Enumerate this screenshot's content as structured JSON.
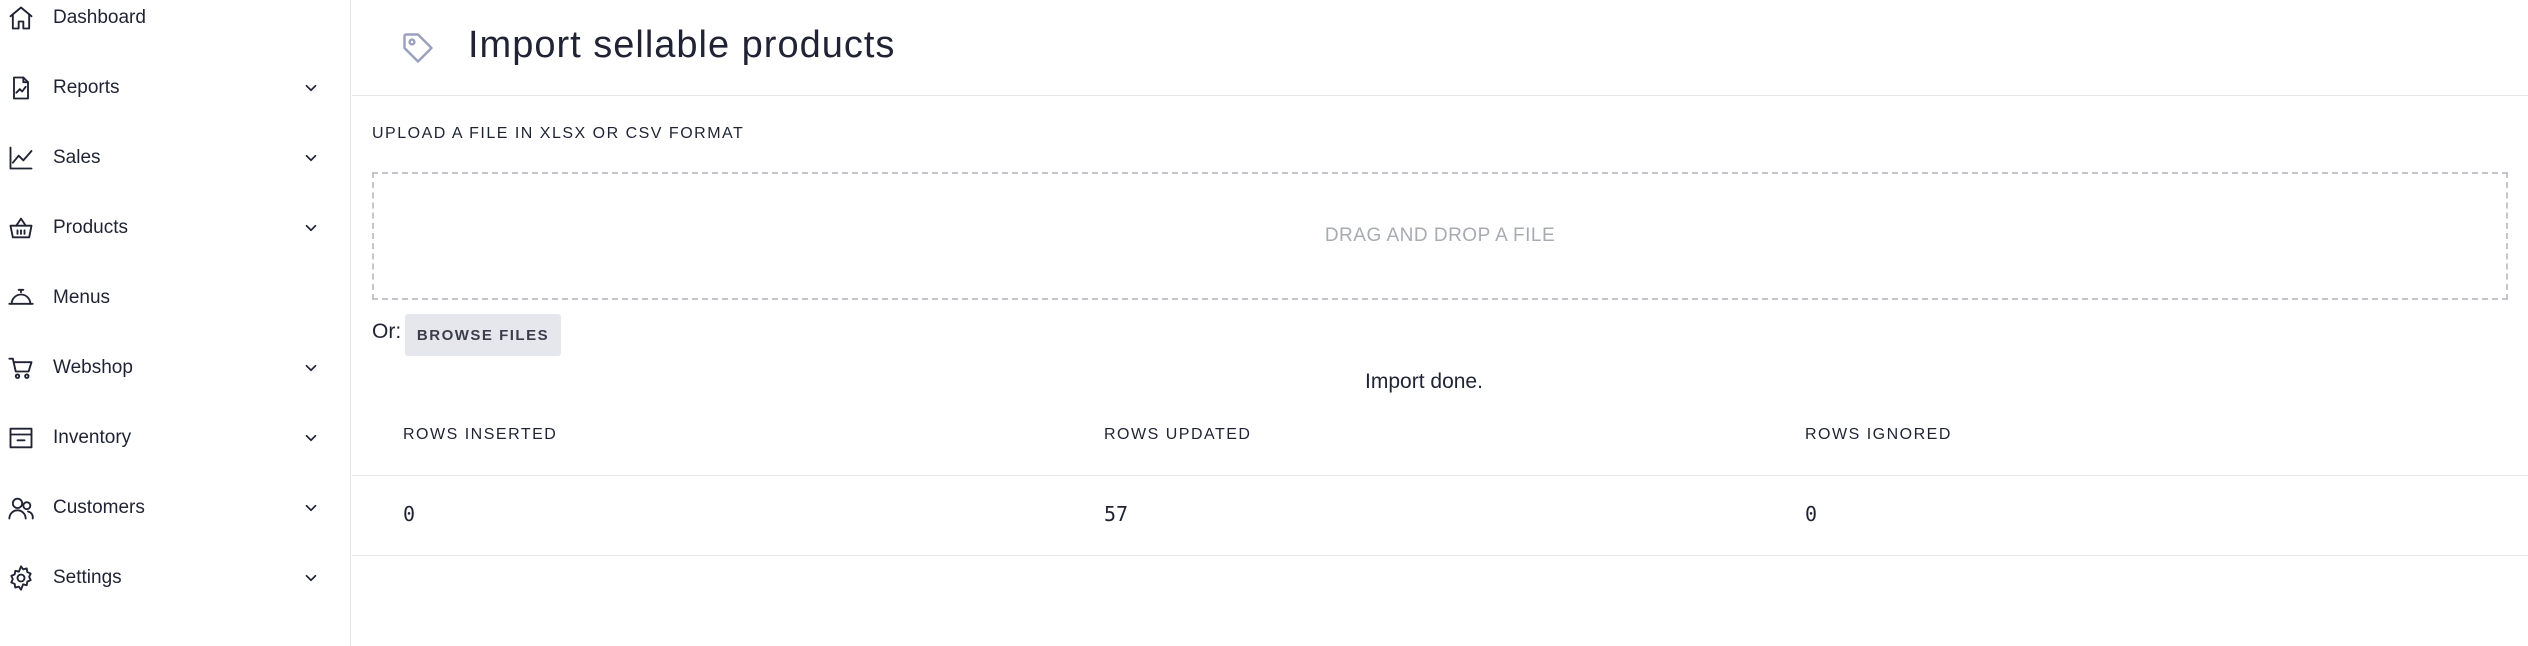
{
  "sidebar": {
    "items": [
      {
        "label": "Dashboard",
        "icon": "home-icon",
        "expandable": false
      },
      {
        "label": "Reports",
        "icon": "report-icon",
        "expandable": true
      },
      {
        "label": "Sales",
        "icon": "line-chart-icon",
        "expandable": true
      },
      {
        "label": "Products",
        "icon": "basket-icon",
        "expandable": true
      },
      {
        "label": "Menus",
        "icon": "cloche-icon",
        "expandable": false
      },
      {
        "label": "Webshop",
        "icon": "cart-icon",
        "expandable": true
      },
      {
        "label": "Inventory",
        "icon": "store-icon",
        "expandable": true
      },
      {
        "label": "Customers",
        "icon": "users-icon",
        "expandable": true
      },
      {
        "label": "Settings",
        "icon": "gear-icon",
        "expandable": true
      }
    ]
  },
  "header": {
    "title": "Import sellable products",
    "icon": "tag-icon"
  },
  "upload": {
    "label": "UPLOAD A FILE IN XLSX OR CSV FORMAT",
    "dropzone_text": "DRAG AND DROP A FILE",
    "or_label": "Or:",
    "browse_label": "BROWSE FILES"
  },
  "status": "Import done.",
  "results": {
    "columns": [
      "ROWS INSERTED",
      "ROWS UPDATED",
      "ROWS IGNORED"
    ],
    "values": [
      "0",
      "57",
      "0"
    ]
  }
}
